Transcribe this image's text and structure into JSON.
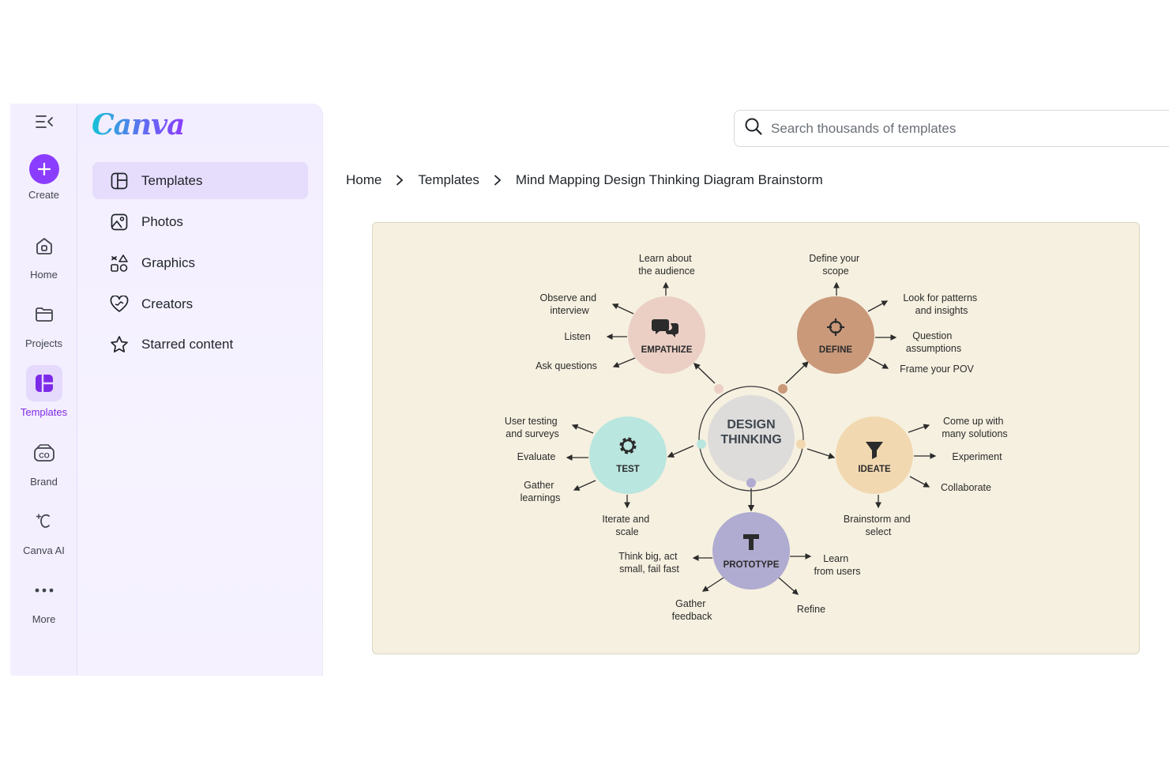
{
  "rail": {
    "items": [
      {
        "label": "Create"
      },
      {
        "label": "Home"
      },
      {
        "label": "Projects"
      },
      {
        "label": "Templates"
      },
      {
        "label": "Brand"
      },
      {
        "label": "Canva AI"
      },
      {
        "label": "More"
      }
    ]
  },
  "panel": {
    "logo": "Canva",
    "items": [
      {
        "label": "Templates"
      },
      {
        "label": "Photos"
      },
      {
        "label": "Graphics"
      },
      {
        "label": "Creators"
      },
      {
        "label": "Starred content"
      }
    ]
  },
  "search": {
    "placeholder": "Search thousands of templates"
  },
  "breadcrumb": [
    "Home",
    "Templates",
    "Mind Mapping Design Thinking Diagram Brainstorm"
  ],
  "diagram": {
    "center": [
      "DESIGN",
      "THINKING"
    ],
    "empathize": {
      "title": "EMPATHIZE",
      "items": [
        "Learn about",
        "the audience",
        "Observe and",
        "interview",
        "Listen",
        "Ask questions"
      ]
    },
    "define": {
      "title": "DEFINE",
      "items": [
        "Define your",
        "scope",
        "Look for patterns",
        "and insights",
        "Question",
        "assumptions",
        "Frame your POV"
      ]
    },
    "ideate": {
      "title": "IDEATE",
      "items": [
        "Come up with",
        "many solutions",
        "Experiment",
        "Collaborate",
        "Brainstorm and",
        "select"
      ]
    },
    "prototype": {
      "title": "PROTOTYPE",
      "items": [
        "Think big, act",
        "small, fail fast",
        "Learn",
        "from users",
        "Gather",
        "feedback",
        "Refine"
      ]
    },
    "test": {
      "title": "TEST",
      "items": [
        "User testing",
        "and surveys",
        "Evaluate",
        "Gather",
        "learnings",
        "Iterate and",
        "scale"
      ]
    },
    "colors": {
      "empathize": "#ebcfc5",
      "define": "#c9997a",
      "ideate": "#f2d8b0",
      "prototype": "#b0abd0",
      "test": "#b9e6df",
      "center": "#dedcda",
      "accent": "#8b3dff"
    }
  }
}
